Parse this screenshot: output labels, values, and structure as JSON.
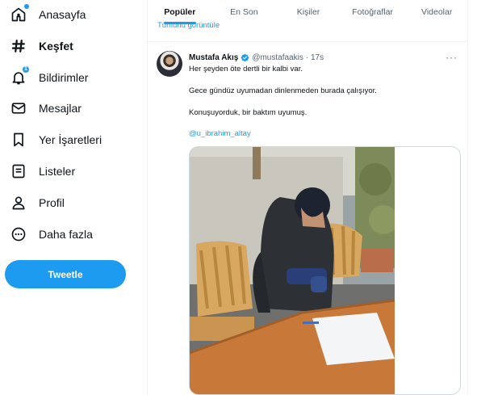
{
  "sidebar": {
    "items": [
      {
        "label": "Anasayfa",
        "icon": "home-icon"
      },
      {
        "label": "Keşfet",
        "icon": "hashtag-icon"
      },
      {
        "label": "Bildirimler",
        "icon": "bell-icon",
        "badge": "1"
      },
      {
        "label": "Mesajlar",
        "icon": "mail-icon"
      },
      {
        "label": "Yer İşaretleri",
        "icon": "bookmark-icon"
      },
      {
        "label": "Listeler",
        "icon": "list-icon"
      },
      {
        "label": "Profil",
        "icon": "person-icon"
      },
      {
        "label": "Daha fazla",
        "icon": "more-circle-icon"
      }
    ],
    "tweet_button": "Tweetle"
  },
  "main": {
    "tabs": [
      {
        "label": "Popüler",
        "active": true
      },
      {
        "label": "En Son",
        "active": false
      },
      {
        "label": "Kişiler",
        "active": false
      },
      {
        "label": "Fotoğraflar",
        "active": false
      },
      {
        "label": "Videolar",
        "active": false
      }
    ],
    "show_link": "Tümünü görüntüle"
  },
  "tweet": {
    "author": "Mustafa Akış",
    "handle": "@mustafaakis",
    "time": "· 17s",
    "lines": [
      "Her şeyden öte dertli bir kalbi var.",
      "Gece gündüz uyumadan dinlenmeden burada çalışıyor.",
      "Konuşuyorduk, bir baktım uyumuş."
    ],
    "mention": "@u_ibrahim_altay",
    "more": "···"
  },
  "colors": {
    "accent": "#1d9bf0",
    "text": "#0f1419",
    "secondary_text": "#536471",
    "border": "#eff3f4"
  }
}
